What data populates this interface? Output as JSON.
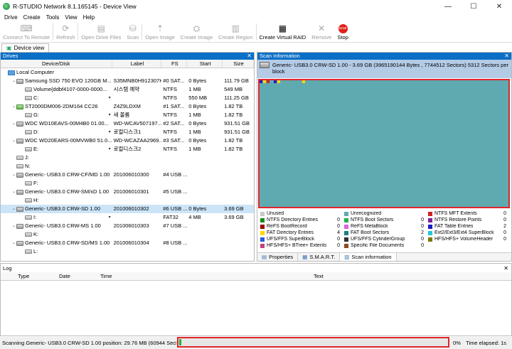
{
  "window": {
    "title": "R-STUDIO Network 8.1.165145 - Device View",
    "minimize": "—",
    "maximize": "☐",
    "close": "✕"
  },
  "menu": [
    "Drive",
    "Create",
    "Tools",
    "View",
    "Help"
  ],
  "toolbar": [
    {
      "label": "Connect To Remote",
      "icon": "plug-icon",
      "glyph": "⌨",
      "enabled": false
    },
    {
      "label": "Refresh",
      "icon": "refresh-icon",
      "glyph": "⟳",
      "enabled": false
    },
    {
      "label": "Open Drive Files",
      "icon": "folder-icon",
      "glyph": "▤",
      "enabled": false
    },
    {
      "label": "Scan",
      "icon": "scan-icon",
      "glyph": "⛁",
      "enabled": false
    },
    {
      "label": "Open Image",
      "icon": "open-image-icon",
      "glyph": "⇡",
      "enabled": false
    },
    {
      "label": "Create Image",
      "icon": "create-image-icon",
      "glyph": "⛭",
      "enabled": false
    },
    {
      "label": "Create Region",
      "icon": "region-icon",
      "glyph": "▥",
      "enabled": false
    },
    {
      "label": "Create Virtual RAID",
      "icon": "raid-icon",
      "glyph": "▦",
      "enabled": true
    },
    {
      "label": "Remove",
      "icon": "remove-icon",
      "glyph": "✕",
      "enabled": false
    },
    {
      "label": "Stop",
      "icon": "stop-icon",
      "glyph": "STOP",
      "enabled": true
    }
  ],
  "tabs": {
    "device_view": "Device view"
  },
  "drives_panel": {
    "title": "Drives",
    "close": "✕",
    "columns": [
      "Device/Disk",
      "Label",
      "FS",
      "Start",
      "Size"
    ],
    "rows": [
      {
        "indent": 0,
        "twist": "",
        "icon": "pc",
        "name": "Local Computer",
        "label": "",
        "fs": "",
        "start": "",
        "size": "",
        "dd": false,
        "sel": false
      },
      {
        "indent": 1,
        "twist": "⌄",
        "icon": "hdd",
        "name": "Samsung SSD 750 EVO 120GB M...",
        "label": "S35MNB0H912307H",
        "fs": "#0 SAT...",
        "start": "0 Bytes",
        "size": "111.79 GB",
        "dd": false,
        "sel": false
      },
      {
        "indent": 2,
        "twist": "",
        "icon": "vol",
        "name": "Volume{ddbf4107-0000-0000...",
        "label": "시스템 예약",
        "fs": "NTFS",
        "start": "1 MB",
        "size": "549 MB",
        "dd": false,
        "sel": false
      },
      {
        "indent": 2,
        "twist": "",
        "icon": "vol",
        "name": "C:",
        "label": "",
        "fs": "NTFS",
        "start": "550 MB",
        "size": "111.25 GB",
        "dd": true,
        "sel": false
      },
      {
        "indent": 1,
        "twist": "⌄",
        "icon": "green",
        "name": "ST2000DM006-2DM164 CC26",
        "label": "Z4Z9LDXM",
        "fs": "#1 SAT...",
        "start": "0 Bytes",
        "size": "1.82 TB",
        "dd": false,
        "sel": false
      },
      {
        "indent": 2,
        "twist": "",
        "icon": "vol",
        "name": "G:",
        "label": "새 볼륨",
        "fs": "NTFS",
        "start": "1 MB",
        "size": "1.82 TB",
        "dd": true,
        "sel": false
      },
      {
        "indent": 1,
        "twist": "⌄",
        "icon": "hdd",
        "name": "WDC WD10EAVS-00M4B0 01.00...",
        "label": "WD-WCAV507197...",
        "fs": "#2 SAT...",
        "start": "0 Bytes",
        "size": "931.51 GB",
        "dd": false,
        "sel": false
      },
      {
        "indent": 2,
        "twist": "",
        "icon": "vol",
        "name": "D:",
        "label": "로컬디스크1",
        "fs": "NTFS",
        "start": "1 MB",
        "size": "931.51 GB",
        "dd": true,
        "sel": false
      },
      {
        "indent": 1,
        "twist": "⌄",
        "icon": "hdd",
        "name": "WDC WD20EARS-00MVWB0 51.0...",
        "label": "WD-WCAZAA2969...",
        "fs": "#3 SAT...",
        "start": "0 Bytes",
        "size": "1.82 TB",
        "dd": false,
        "sel": false
      },
      {
        "indent": 2,
        "twist": "",
        "icon": "vol",
        "name": "E:",
        "label": "로컬디스크2",
        "fs": "NTFS",
        "start": "1 MB",
        "size": "1.82 TB",
        "dd": true,
        "sel": false
      },
      {
        "indent": 1,
        "twist": "",
        "icon": "vol",
        "name": "J:",
        "label": "",
        "fs": "",
        "start": "",
        "size": "",
        "dd": false,
        "sel": false
      },
      {
        "indent": 1,
        "twist": "",
        "icon": "vol",
        "name": "N:",
        "label": "",
        "fs": "",
        "start": "",
        "size": "",
        "dd": false,
        "sel": false
      },
      {
        "indent": 1,
        "twist": "⌄",
        "icon": "hdd",
        "name": "Generic- USB3.0 CRW-CF/MD 1.00",
        "label": "201006010300",
        "fs": "#4 USB ...",
        "start": "",
        "size": "",
        "dd": false,
        "sel": false
      },
      {
        "indent": 2,
        "twist": "",
        "icon": "vol",
        "name": "F:",
        "label": "",
        "fs": "",
        "start": "",
        "size": "",
        "dd": false,
        "sel": false
      },
      {
        "indent": 1,
        "twist": "⌄",
        "icon": "hdd",
        "name": "Generic- USB3.0 CRW-SM/xD 1.00",
        "label": "201006010301",
        "fs": "#5 USB ...",
        "start": "",
        "size": "",
        "dd": false,
        "sel": false
      },
      {
        "indent": 2,
        "twist": "",
        "icon": "vol",
        "name": "H:",
        "label": "",
        "fs": "",
        "start": "",
        "size": "",
        "dd": false,
        "sel": false
      },
      {
        "indent": 1,
        "twist": "⌄",
        "icon": "hdd",
        "name": "Generic- USB3.0 CRW-SD 1.00",
        "label": "201006010302",
        "fs": "#6 USB ...",
        "start": "0 Bytes",
        "size": "3.69 GB",
        "dd": false,
        "sel": true
      },
      {
        "indent": 2,
        "twist": "",
        "icon": "vol",
        "name": "I:",
        "label": "",
        "fs": "FAT32",
        "start": "4 MB",
        "size": "3.69 GB",
        "dd": true,
        "sel": false
      },
      {
        "indent": 1,
        "twist": "⌄",
        "icon": "hdd",
        "name": "Generic- USB3.0 CRW-MS 1.00",
        "label": "201006010303",
        "fs": "#7 USB ...",
        "start": "",
        "size": "",
        "dd": false,
        "sel": false
      },
      {
        "indent": 2,
        "twist": "",
        "icon": "vol",
        "name": "K:",
        "label": "",
        "fs": "",
        "start": "",
        "size": "",
        "dd": false,
        "sel": false
      },
      {
        "indent": 1,
        "twist": "⌄",
        "icon": "hdd",
        "name": "Generic- USB3.0 CRW-SD/MS 1.00",
        "label": "201006010304",
        "fs": "#8 USB ...",
        "start": "",
        "size": "",
        "dd": false,
        "sel": false
      },
      {
        "indent": 2,
        "twist": "",
        "icon": "vol",
        "name": "L:",
        "label": "",
        "fs": "",
        "start": "",
        "size": "",
        "dd": false,
        "sel": false
      }
    ]
  },
  "scan_panel": {
    "title": "Scan Information",
    "close": "✕",
    "device": "Generic- USB3.0 CRW-SD 1.00 - 3.69 GB (3965190144 Bytes , 7744512 Sectors) 5312 Sectors per block",
    "grid_color": "#5faab0",
    "legend": [
      [
        {
          "name": "Unused",
          "color": "#c8c8c8",
          "count": ""
        },
        {
          "name": "Unrecognized",
          "color": "#5faab0",
          "count": ""
        },
        {
          "name": "NTFS MFT Extents",
          "color": "#d42020",
          "count": "0"
        }
      ],
      [
        {
          "name": "NTFS Directory Entries",
          "color": "#1a8a1a",
          "count": "0"
        },
        {
          "name": "NTFS Boot Sectors",
          "color": "#22b14c",
          "count": "0"
        },
        {
          "name": "NTFS Restore Points",
          "color": "#7f1f9f",
          "count": "0"
        }
      ],
      [
        {
          "name": "ReFS BootRecord",
          "color": "#a00000",
          "count": "0"
        },
        {
          "name": "ReFS MetaBlock",
          "color": "#e060e0",
          "count": "0"
        },
        {
          "name": "FAT Table Entries",
          "color": "#1c1cc8",
          "count": "2"
        }
      ],
      [
        {
          "name": "FAT Directory Entries",
          "color": "#ffd800",
          "count": "4"
        },
        {
          "name": "FAT Boot Sectors",
          "color": "#1f7f7f",
          "count": "2"
        },
        {
          "name": "Ext2/Ext3/Ext4 SuperBlock",
          "color": "#22c8d8",
          "count": "0"
        }
      ],
      [
        {
          "name": "UFS/FFS SuperBlock",
          "color": "#2a5ad8",
          "count": "0"
        },
        {
          "name": "UFS/FFS CylinderGroup",
          "color": "#303030",
          "count": "0"
        },
        {
          "name": "HFS/HFS+ VolumeHeader",
          "color": "#7a7a00",
          "count": "0"
        }
      ],
      [
        {
          "name": "HFS/HFS+ BTree+ Extents",
          "color": "#c04080",
          "count": "0"
        },
        {
          "name": "Specific File Documents",
          "color": "#8a4a20",
          "count": "0"
        }
      ]
    ],
    "tabs": [
      {
        "label": "Properties",
        "icon": "properties-icon",
        "glyph": "▤"
      },
      {
        "label": "S.M.A.R.T.",
        "icon": "smart-icon",
        "glyph": "▦"
      },
      {
        "label": "Scan information",
        "icon": "scan-info-icon",
        "glyph": "▥"
      }
    ]
  },
  "log": {
    "title": "Log",
    "close": "✕",
    "columns": [
      "Type",
      "Date",
      "Time",
      "Text"
    ]
  },
  "status": {
    "text": "Scanning Generic- USB3.0 CRW-SD 1.00 position: 29.76 MB (60944 Sectors)",
    "progress": 0.8,
    "percent": "0%",
    "time": "Time elapsed: 1s"
  }
}
